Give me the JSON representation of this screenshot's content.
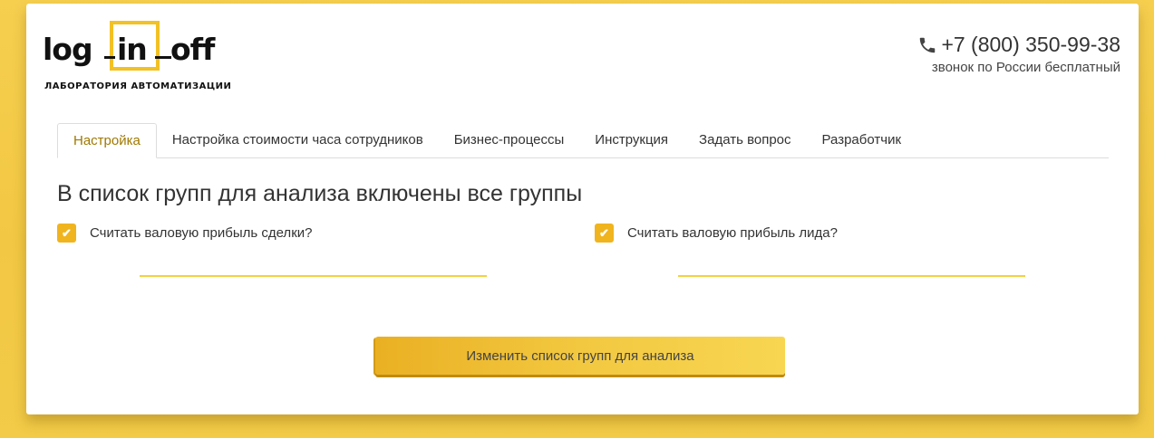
{
  "brand": {
    "logo_parts": [
      "log",
      "in",
      "off"
    ],
    "tagline": "ЛАБОРАТОРИЯ АВТОМАТИЗАЦИИ",
    "accent_color": "#f2c124"
  },
  "contacts": {
    "phone_icon": "phone-icon",
    "phone": "+7 (800) 350-99-38",
    "note": "звонок по России бесплатный"
  },
  "tabs": [
    {
      "label": "Настройка",
      "active": true
    },
    {
      "label": "Настройка стоимости часа сотрудников",
      "active": false
    },
    {
      "label": "Бизнес-процессы",
      "active": false
    },
    {
      "label": "Инструкция",
      "active": false
    },
    {
      "label": "Задать вопрос",
      "active": false
    },
    {
      "label": "Разработчик",
      "active": false
    }
  ],
  "main": {
    "title": "В список групп для анализа включены все группы",
    "checkboxes": [
      {
        "label": "Считать валовую прибыль сделки?",
        "checked": true
      },
      {
        "label": "Считать валовую прибыль лида?",
        "checked": true
      }
    ],
    "checkmark": "✔",
    "button_label": "Изменить список групп для анализа"
  },
  "colors": {
    "background": "#f3c946",
    "active_tab_text": "#a07800",
    "checkbox": "#f0b41e",
    "button_gradient_start": "#eab023",
    "button_gradient_end": "#f8d652"
  }
}
